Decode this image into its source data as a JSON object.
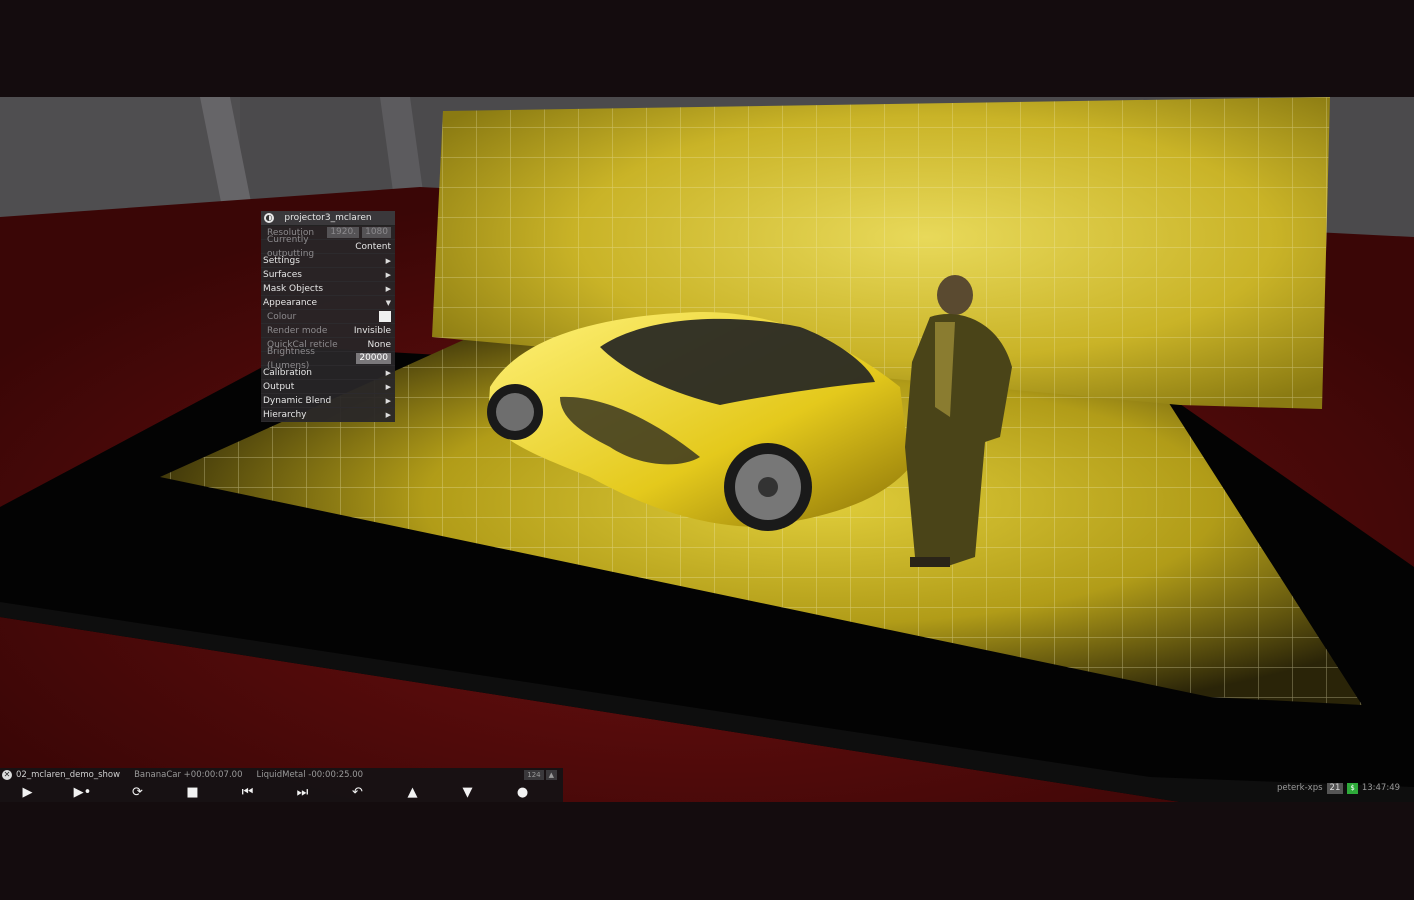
{
  "properties_panel": {
    "title": "projector3_mclaren",
    "resolution_label": "Resolution",
    "resolution_width": "1920.",
    "resolution_height": "1080",
    "outputting_label": "Currently outputting",
    "outputting_value": "Content",
    "sections": {
      "settings": "Settings",
      "surfaces": "Surfaces",
      "mask_objects": "Mask Objects",
      "appearance": "Appearance",
      "calibration": "Calibration",
      "output": "Output",
      "dynamic_blend": "Dynamic Blend",
      "hierarchy": "Hierarchy"
    },
    "appearance_fields": {
      "colour_label": "Colour",
      "render_mode_label": "Render mode",
      "render_mode_value": "Invisible",
      "quickcal_label": "QuickCal reticle",
      "quickcal_value": "None",
      "brightness_label": "Brightness (Lumens)",
      "brightness_value": "20000"
    }
  },
  "transport": {
    "show_name": "02_mclaren_demo_show",
    "track1": "BananaCar +00:00:07.00",
    "track2": "LiquidMetal -00:00:25.00",
    "mini_value": "124",
    "buttons": {
      "play": "▶",
      "play_next": "▶•",
      "loop": "⟳",
      "stop": "■",
      "prev": "⏮",
      "next": "⏭",
      "undo": "↶",
      "up": "▲",
      "down": "▼",
      "record": "●"
    }
  },
  "tray": {
    "host": "peterk-xps",
    "workspace": "21",
    "battery": "$",
    "time": "13:47:49"
  },
  "colors": {
    "floor": "#5a0a0a",
    "stage": "#050505",
    "projection_yellow": "#d9c21a",
    "panel_bg": "#282628"
  }
}
